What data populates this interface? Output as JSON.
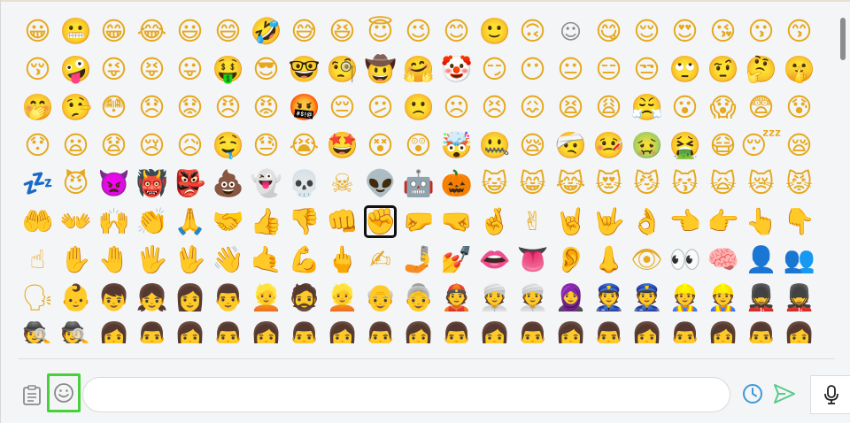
{
  "emoji_grid": {
    "emojis": [
      "😀",
      "😬",
      "😁",
      "😂",
      "😃",
      "😄",
      "🤣",
      "😅",
      "😆",
      "😇",
      "😉",
      "😊",
      "🙂",
      "🙃",
      "☺",
      "😋",
      "😌",
      "😍",
      "😘",
      "😗",
      "😙",
      "😚",
      "🤪",
      "😜",
      "😝",
      "😛",
      "🤑",
      "😎",
      "🤓",
      "🧐",
      "🤠",
      "🤗",
      "🤡",
      "😏",
      "😶",
      "😐",
      "😑",
      "😒",
      "🙄",
      "🤨",
      "🤔",
      "🤫",
      "🤭",
      "🤥",
      "😳",
      "😞",
      "😟",
      "😠",
      "😡",
      "🤬",
      "😔",
      "😕",
      "🙁",
      "☹",
      "😣",
      "😖",
      "😫",
      "😩",
      "😤",
      "😮",
      "😱",
      "😨",
      "😰",
      "😯",
      "😦",
      "😧",
      "😢",
      "😥",
      "🤤",
      "😓",
      "😭",
      "🤩",
      "😵",
      "😲",
      "🤯",
      "🤐",
      "😪",
      "🤕",
      "🤒",
      "🤢",
      "🤮",
      "😷",
      "😴",
      "😪",
      "💤",
      "😈",
      "👿",
      "👹",
      "👺",
      "💩",
      "👻",
      "💀",
      "☠",
      "👽",
      "🤖",
      "🎃",
      "😺",
      "😸",
      "😹",
      "😻",
      "😼",
      "😽",
      "🙀",
      "😿",
      "😾",
      "🤲",
      "👐",
      "🙌",
      "👏",
      "🙏",
      "🤝",
      "👍",
      "👎",
      "👊",
      "✊",
      "🤛",
      "🤜",
      "🤞",
      "✌",
      "🤘",
      "🤟",
      "👌",
      "👈",
      "👉",
      "👆",
      "👇",
      "☝",
      "✋",
      "🤚",
      "🖐",
      "🖖",
      "👋",
      "🤙",
      "💪",
      "🖕",
      "✍",
      "🤳",
      "💅",
      "👄",
      "👅",
      "👂",
      "👃",
      "👁",
      "👀",
      "🧠",
      "👤",
      "👥",
      "🗣",
      "👶",
      "👦",
      "👧",
      "👩",
      "👨",
      "👱",
      "🧔",
      "👱",
      "👴",
      "👵",
      "👲",
      "👳",
      "👳",
      "🧕",
      "👮",
      "👮",
      "👷",
      "👷",
      "💂",
      "💂",
      "🕵",
      "🕵",
      "👩",
      "👨",
      "👩",
      "👨",
      "👩",
      "👨",
      "👩",
      "👨",
      "👩",
      "👨",
      "👩",
      "👨",
      "👩",
      "👨",
      "👩",
      "👨",
      "👩",
      "👨",
      "👩"
    ],
    "selected_index": 114
  },
  "compose": {
    "input_value": "",
    "input_placeholder": ""
  },
  "colors": {
    "selected_button_border": "#46d13b",
    "send_icon": "#58c98a",
    "schedule_icon": "#3b9bd6"
  },
  "icons": {
    "attach": "clipboard-icon",
    "emoji": "smiley-icon",
    "schedule": "clock-icon",
    "send": "send-icon",
    "mic": "microphone-icon"
  }
}
